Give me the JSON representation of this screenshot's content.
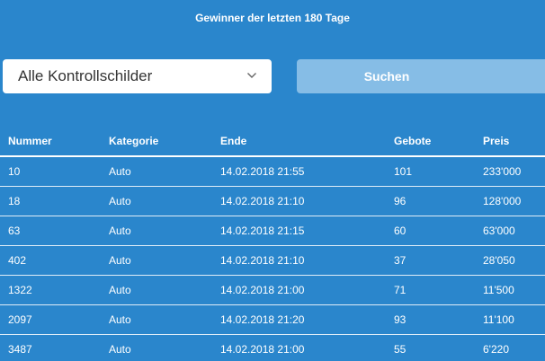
{
  "header": {
    "title": "Gewinner der letzten 180 Tage"
  },
  "filter": {
    "selected": "Alle Kontrollschilder",
    "chevron_icon": "chevron-down-icon"
  },
  "search_button": {
    "label": "Suchen"
  },
  "table": {
    "columns": [
      "Nummer",
      "Kategorie",
      "Ende",
      "Gebote",
      "Preis"
    ],
    "rows": [
      [
        "10",
        "Auto",
        "14.02.2018 21:55",
        "101",
        "233'000"
      ],
      [
        "18",
        "Auto",
        "14.02.2018 21:10",
        "96",
        "128'000"
      ],
      [
        "63",
        "Auto",
        "14.02.2018 21:15",
        "60",
        "63'000"
      ],
      [
        "402",
        "Auto",
        "14.02.2018 21:10",
        "37",
        "28'050"
      ],
      [
        "1322",
        "Auto",
        "14.02.2018 21:00",
        "71",
        "11'500"
      ],
      [
        "2097",
        "Auto",
        "14.02.2018 21:20",
        "93",
        "11'100"
      ],
      [
        "3487",
        "Auto",
        "14.02.2018 21:00",
        "55",
        "6'220"
      ]
    ]
  },
  "colors": {
    "background": "#2a86cc",
    "button_background": "#86bde6",
    "text": "#ffffff"
  }
}
